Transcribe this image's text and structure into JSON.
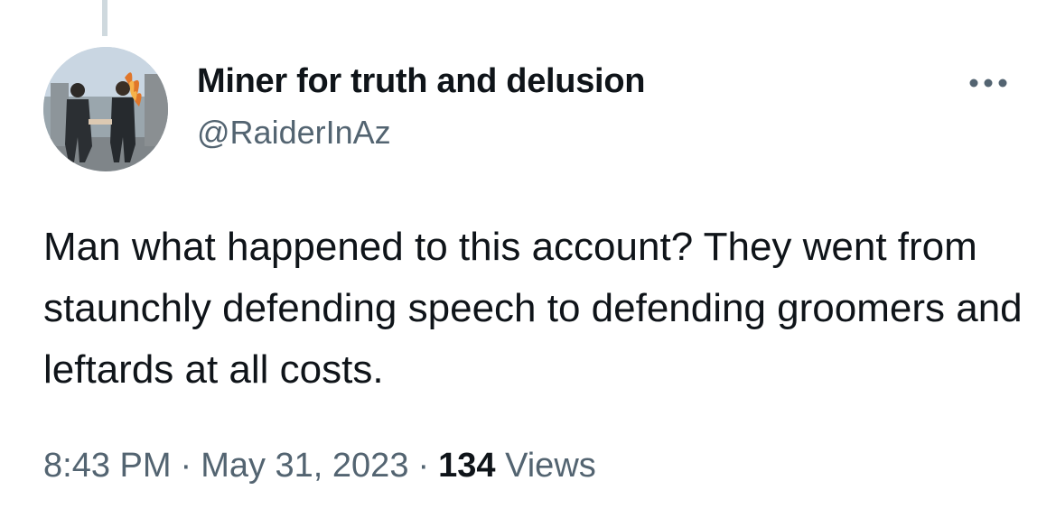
{
  "tweet": {
    "author": {
      "display_name": "Miner for truth and delusion",
      "handle": "@RaiderInAz"
    },
    "more_icon": "more-horizontal-icon",
    "text": "Man what happened to this account? They went from staunchly defending speech to defending groomers and leftards at all costs.",
    "time": "8:43 PM",
    "separator": "·",
    "date": "May 31, 2023",
    "views_count": "134",
    "views_label": "Views"
  },
  "colors": {
    "primary_text": "#0f1419",
    "secondary_text": "#536471",
    "thread_line": "#cfd9de",
    "background": "#ffffff"
  }
}
